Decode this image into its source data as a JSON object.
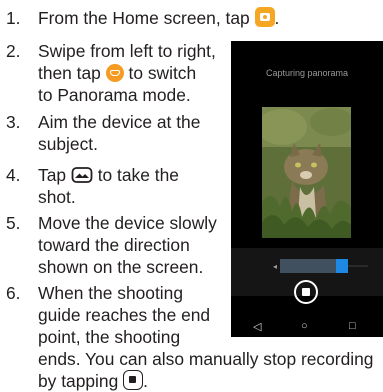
{
  "steps": [
    {
      "number": "1.",
      "lines": [
        "From the Home screen, tap ",
        "."
      ],
      "icon": "camera-app-icon"
    },
    {
      "number": "2.",
      "lines": [
        "Swipe from left to right,",
        "then tap ",
        " to switch",
        "to Panorama mode."
      ],
      "icon": "panorama-mode-icon"
    },
    {
      "number": "3.",
      "lines": [
        "Aim the device at the",
        "subject."
      ]
    },
    {
      "number": "4.",
      "lines": [
        "Tap ",
        " to take the",
        "shot."
      ],
      "icon": "panorama-shutter-icon"
    },
    {
      "number": "5.",
      "lines": [
        "Move the device slowly",
        "toward the direction",
        "shown on the screen."
      ]
    },
    {
      "number": "6.",
      "lines": [
        "When the shooting",
        "guide reaches the end",
        "point, the shooting",
        "ends. You can also manually stop recording",
        "by tapping ",
        "."
      ],
      "icon": "stop-recording-icon"
    }
  ],
  "phone": {
    "status_text": "Capturing panorama",
    "guide_progress_percent": 88,
    "guide_arrow": "◂",
    "nav_back": "◁",
    "nav_home": "○",
    "nav_recent": "□",
    "colors": {
      "background": "#000000",
      "guide_handle": "#1e88e5",
      "guide_bar": "#40505e"
    }
  },
  "colors": {
    "text": "#231f20",
    "camera_icon": "#f5a623"
  }
}
